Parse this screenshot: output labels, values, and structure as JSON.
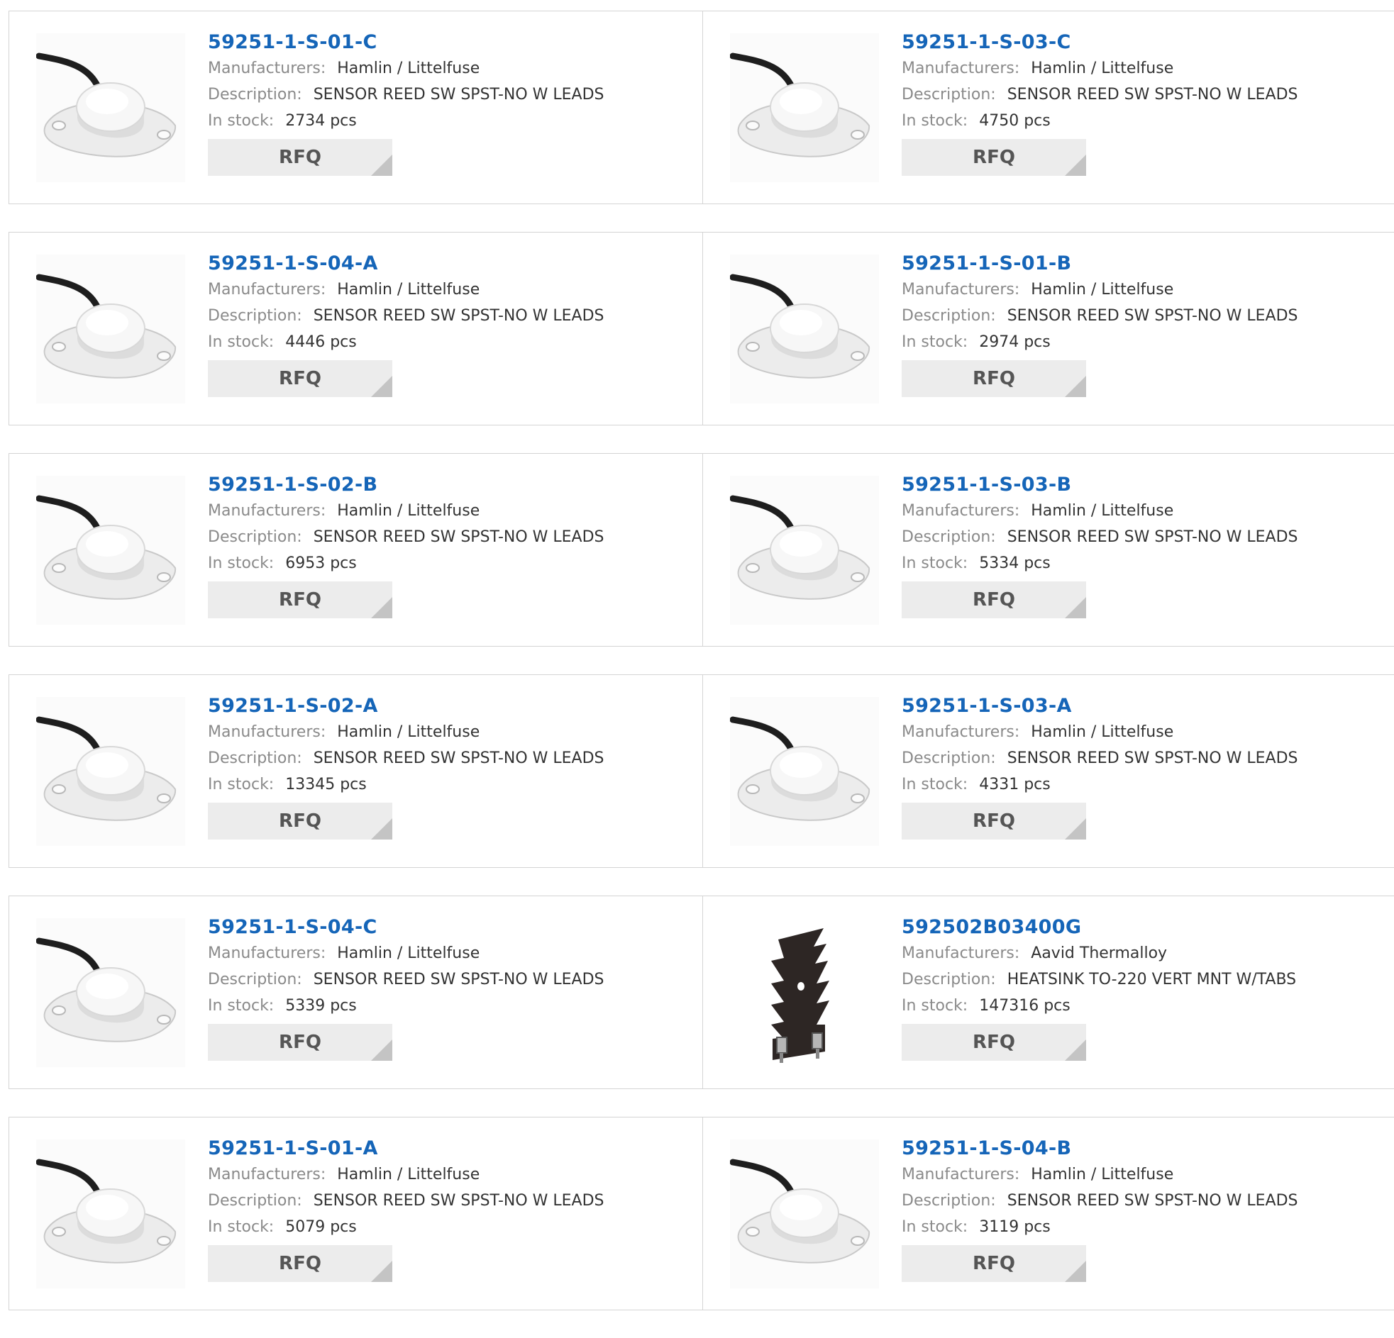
{
  "labels": {
    "manufacturers": "Manufacturers:",
    "description": "Description:",
    "in_stock": "In stock:",
    "rfq": "RFQ"
  },
  "colors": {
    "part_link": "#1565b8",
    "rfq_bg": "#ececec",
    "border": "#d4d4d4"
  },
  "products": [
    {
      "part": "59251-1-S-01-C",
      "manufacturer": "Hamlin / Littelfuse",
      "description": "SENSOR REED SW SPST-NO W LEADS",
      "stock": "2734 pcs",
      "image": "reed-sensor-image"
    },
    {
      "part": "59251-1-S-03-C",
      "manufacturer": "Hamlin / Littelfuse",
      "description": "SENSOR REED SW SPST-NO W LEADS",
      "stock": "4750 pcs",
      "image": "reed-sensor-image"
    },
    {
      "part": "59251-1-S-04-A",
      "manufacturer": "Hamlin / Littelfuse",
      "description": "SENSOR REED SW SPST-NO W LEADS",
      "stock": "4446 pcs",
      "image": "reed-sensor-image"
    },
    {
      "part": "59251-1-S-01-B",
      "manufacturer": "Hamlin / Littelfuse",
      "description": "SENSOR REED SW SPST-NO W LEADS",
      "stock": "2974 pcs",
      "image": "reed-sensor-image"
    },
    {
      "part": "59251-1-S-02-B",
      "manufacturer": "Hamlin / Littelfuse",
      "description": "SENSOR REED SW SPST-NO W LEADS",
      "stock": "6953 pcs",
      "image": "reed-sensor-image"
    },
    {
      "part": "59251-1-S-03-B",
      "manufacturer": "Hamlin / Littelfuse",
      "description": "SENSOR REED SW SPST-NO W LEADS",
      "stock": "5334 pcs",
      "image": "reed-sensor-image"
    },
    {
      "part": "59251-1-S-02-A",
      "manufacturer": "Hamlin / Littelfuse",
      "description": "SENSOR REED SW SPST-NO W LEADS",
      "stock": "13345 pcs",
      "image": "reed-sensor-image"
    },
    {
      "part": "59251-1-S-03-A",
      "manufacturer": "Hamlin / Littelfuse",
      "description": "SENSOR REED SW SPST-NO W LEADS",
      "stock": "4331 pcs",
      "image": "reed-sensor-image"
    },
    {
      "part": "59251-1-S-04-C",
      "manufacturer": "Hamlin / Littelfuse",
      "description": "SENSOR REED SW SPST-NO W LEADS",
      "stock": "5339 pcs",
      "image": "reed-sensor-image"
    },
    {
      "part": "592502B03400G",
      "manufacturer": "Aavid Thermalloy",
      "description": "HEATSINK TO-220 VERT MNT W/TABS",
      "stock": "147316 pcs",
      "image": "heatsink-image"
    },
    {
      "part": "59251-1-S-01-A",
      "manufacturer": "Hamlin / Littelfuse",
      "description": "SENSOR REED SW SPST-NO W LEADS",
      "stock": "5079 pcs",
      "image": "reed-sensor-image"
    },
    {
      "part": "59251-1-S-04-B",
      "manufacturer": "Hamlin / Littelfuse",
      "description": "SENSOR REED SW SPST-NO W LEADS",
      "stock": "3119 pcs",
      "image": "reed-sensor-image"
    }
  ]
}
